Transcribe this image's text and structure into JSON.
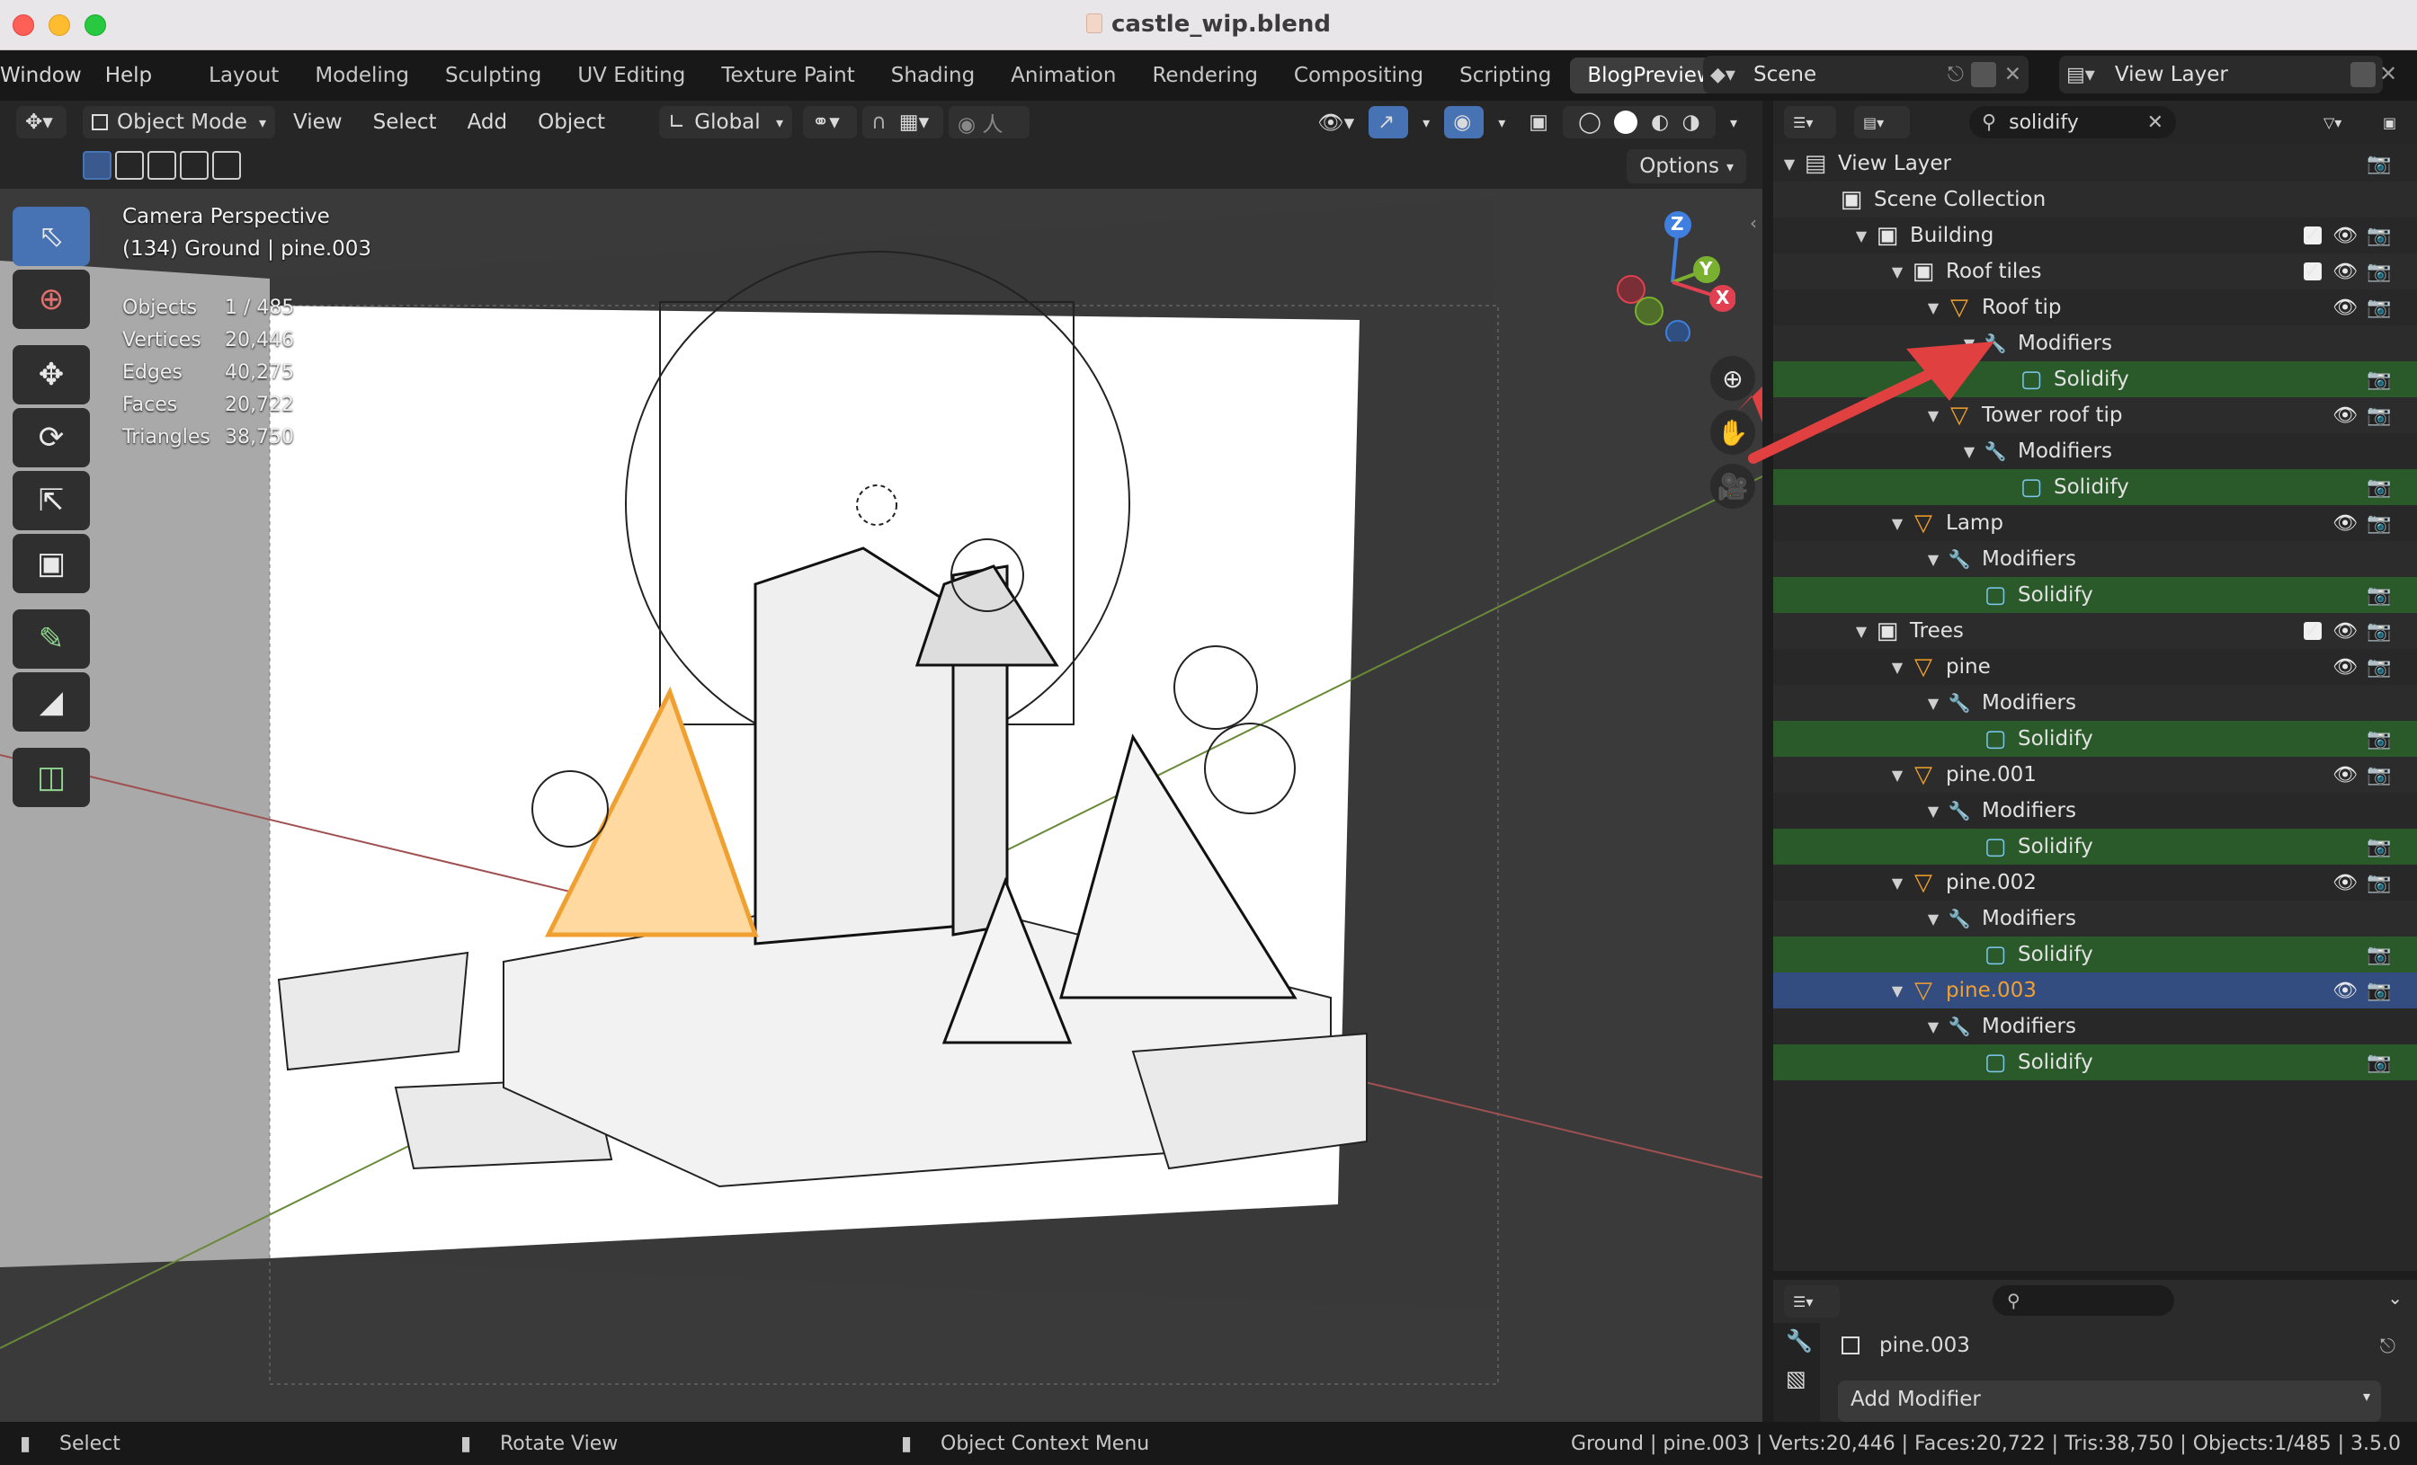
{
  "window": {
    "title": "castle_wip.blend"
  },
  "menu": {
    "window": "Window",
    "help": "Help"
  },
  "workspaces": [
    "Layout",
    "Modeling",
    "Sculpting",
    "UV Editing",
    "Texture Paint",
    "Shading",
    "Animation",
    "Rendering",
    "Compositing",
    "Scripting",
    "BlogPreview"
  ],
  "active_workspace": "BlogPreview",
  "scene": {
    "name": "Scene",
    "view_layer": "View Layer"
  },
  "viewport_header": {
    "mode": "Object Mode",
    "menus": [
      "View",
      "Select",
      "Add",
      "Object"
    ],
    "transform_orientation": "Global",
    "options": "Options"
  },
  "viewport": {
    "view_name": "Camera Perspective",
    "object_info": "(134) Ground | pine.003",
    "stats": [
      {
        "label": "Objects",
        "value": "1 / 485"
      },
      {
        "label": "Vertices",
        "value": "20,446"
      },
      {
        "label": "Edges",
        "value": "40,275"
      },
      {
        "label": "Faces",
        "value": "20,722"
      },
      {
        "label": "Triangles",
        "value": "38,750"
      }
    ],
    "gizmo": {
      "z": "Z",
      "y": "Y",
      "x": "X"
    }
  },
  "outliner": {
    "search": "solidify",
    "rows": [
      {
        "label": "View Layer",
        "type": "viewlayer",
        "depth": 0
      },
      {
        "label": "Scene Collection",
        "type": "scenecol",
        "depth": 1
      },
      {
        "label": "Building",
        "type": "collection",
        "depth": 2
      },
      {
        "label": "Roof tiles",
        "type": "collection",
        "depth": 3
      },
      {
        "label": "Roof tip",
        "type": "mesh",
        "depth": 4
      },
      {
        "label": "Modifiers",
        "type": "modifiers",
        "depth": 5
      },
      {
        "label": "Solidify",
        "type": "solidify",
        "depth": 6
      },
      {
        "label": "Tower roof tip",
        "type": "mesh",
        "depth": 4
      },
      {
        "label": "Modifiers",
        "type": "modifiers",
        "depth": 5
      },
      {
        "label": "Solidify",
        "type": "solidify",
        "depth": 6
      },
      {
        "label": "Lamp",
        "type": "mesh",
        "depth": 3
      },
      {
        "label": "Modifiers",
        "type": "modifiers",
        "depth": 4
      },
      {
        "label": "Solidify",
        "type": "solidify",
        "depth": 5
      },
      {
        "label": "Trees",
        "type": "collection",
        "depth": 2
      },
      {
        "label": "pine",
        "type": "mesh",
        "depth": 3
      },
      {
        "label": "Modifiers",
        "type": "modifiers",
        "depth": 4
      },
      {
        "label": "Solidify",
        "type": "solidify",
        "depth": 5
      },
      {
        "label": "pine.001",
        "type": "mesh",
        "depth": 3
      },
      {
        "label": "Modifiers",
        "type": "modifiers",
        "depth": 4
      },
      {
        "label": "Solidify",
        "type": "solidify",
        "depth": 5
      },
      {
        "label": "pine.002",
        "type": "mesh",
        "depth": 3
      },
      {
        "label": "Modifiers",
        "type": "modifiers",
        "depth": 4
      },
      {
        "label": "Solidify",
        "type": "solidify",
        "depth": 5
      },
      {
        "label": "pine.003",
        "type": "mesh",
        "depth": 3
      },
      {
        "label": "Modifiers",
        "type": "modifiers",
        "depth": 4
      },
      {
        "label": "Solidify",
        "type": "solidify",
        "depth": 5
      }
    ]
  },
  "properties": {
    "object_name": "pine.003",
    "add_modifier": "Add Modifier"
  },
  "statusbar": {
    "left": "Select",
    "middle": "Rotate View",
    "right": "Object Context Menu",
    "info": "Ground | pine.003 | Verts:20,446 | Faces:20,722 | Tris:38,750 | Objects:1/485 | 3.5.0"
  },
  "colors": {
    "accent": "#4772b3",
    "selected_object": "#f0a030",
    "modifier_row": "#2a5a2a",
    "active_row": "#334d80"
  }
}
